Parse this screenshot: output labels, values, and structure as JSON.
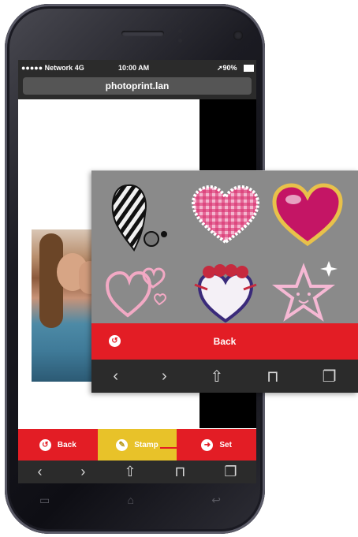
{
  "status_bar": {
    "carrier": "●●●●● Network 4G",
    "time": "10:00 AM",
    "battery": "➚90%"
  },
  "browser": {
    "url": "photoprint.lan"
  },
  "app_bar": {
    "back_label": "Back",
    "stamp_label": "Stamp",
    "set_label": "Set"
  },
  "toolbar_icons": [
    "chevron-left-icon",
    "chevron-right-icon",
    "share-icon",
    "bookmarks-icon",
    "tabs-icon"
  ],
  "stamp_popup": {
    "stamps": [
      "striped-heart-stamp",
      "gingham-heart-stamp",
      "pink-gloss-heart-stamp",
      "outline-hearts-stamp",
      "bird-heart-stamp",
      "sparkle-star-stamp"
    ],
    "back_label": "Back"
  },
  "colors": {
    "accent_red": "#e31d25",
    "accent_yellow": "#e8c229",
    "toolbar_dark": "#2b2b2b"
  }
}
